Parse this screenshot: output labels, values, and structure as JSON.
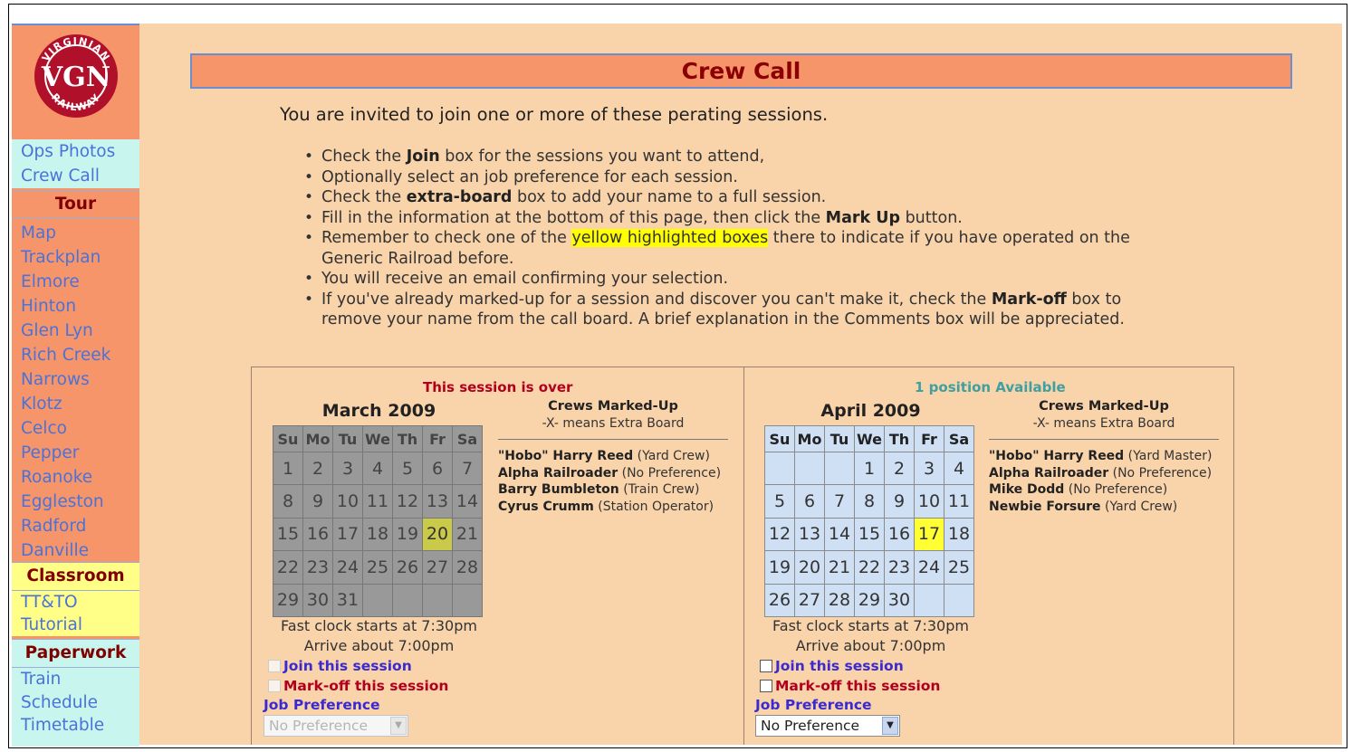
{
  "sidebar": {
    "logo_text": "VIRGINIAN VGN RAILWAY",
    "top_links": [
      "Ops Photos",
      "Crew Call"
    ],
    "tour_heading": "Tour",
    "tour_links": [
      "Map",
      "Trackplan",
      "Elmore",
      "Hinton",
      "Glen Lyn",
      "Rich Creek",
      "Narrows",
      "Klotz",
      "Celco",
      "Pepper",
      "Roanoke",
      "Eggleston",
      "Radford",
      "Danville"
    ],
    "classroom_heading": "Classroom",
    "classroom_links": [
      "TT&TO",
      "Tutorial"
    ],
    "paperwork_heading": "Paperwork",
    "paperwork_links": [
      "Train",
      "Schedule",
      "Timetable"
    ]
  },
  "page": {
    "title": "Crew Call",
    "intro": "You are invited to join one or more of these perating sessions."
  },
  "instructions": {
    "b1_pre": "Check the ",
    "b1_bold": "Join",
    "b1_post": " box for the sessions you want to attend,",
    "b2": "Optionally select an job preference for each session.",
    "b3_pre": "Check the ",
    "b3_bold": "extra-board",
    "b3_post": " box to add your name to a full session.",
    "b4_pre": "Fill in the information at the bottom of this page, then click the ",
    "b4_bold": "Mark Up",
    "b4_post": " button.",
    "b5_pre": "Remember to check one of the ",
    "b5_hl": "yellow highlighted boxes",
    "b5_post": " there to indicate if you have operated on the Generic Railroad before.",
    "b6": "You will receive an email confirming your selection.",
    "b7_pre": "If you've already marked-up for a session and discover you can't make it, check the ",
    "b7_bold": "Mark-off",
    "b7_post": " box to remove your name from the call board. A brief explanation in the Comments box will be appreciated."
  },
  "weekdays": [
    "Su",
    "Mo",
    "Tu",
    "We",
    "Th",
    "Fr",
    "Sa"
  ],
  "sessions": [
    {
      "status": "This session is over",
      "month": "March 2009",
      "weeks": [
        [
          "1",
          "2",
          "3",
          "4",
          "5",
          "6",
          "7"
        ],
        [
          "8",
          "9",
          "10",
          "11",
          "12",
          "13",
          "14"
        ],
        [
          "15",
          "16",
          "17",
          "18",
          "19",
          "20",
          "21"
        ],
        [
          "22",
          "23",
          "24",
          "25",
          "26",
          "27",
          "28"
        ],
        [
          "29",
          "30",
          "31",
          "",
          "",
          "",
          ""
        ]
      ],
      "selected_day": "20",
      "crews_title": "Crews Marked-Up",
      "crews_sub": "-X- means Extra Board",
      "crew": [
        {
          "name": "\"Hobo\" Harry Reed",
          "role": " (Yard Crew)"
        },
        {
          "name": "Alpha Railroader",
          "role": " (No Preference)"
        },
        {
          "name": "Barry Bumbleton",
          "role": " (Train Crew)"
        },
        {
          "name": "Cyrus Crumm",
          "role": " (Station Operator)"
        }
      ],
      "fast_clock": "Fast clock starts at 7:30pm",
      "arrive": "Arrive about 7:00pm",
      "join_label": "Join this session",
      "markoff_label": "Mark-off this session",
      "job_pref_label": "Job Preference",
      "job_pref_value": "No Preference"
    },
    {
      "status": "1 position Available",
      "month": "April 2009",
      "weeks": [
        [
          "",
          "",
          "",
          "1",
          "2",
          "3",
          "4"
        ],
        [
          "5",
          "6",
          "7",
          "8",
          "9",
          "10",
          "11"
        ],
        [
          "12",
          "13",
          "14",
          "15",
          "16",
          "17",
          "18"
        ],
        [
          "19",
          "20",
          "21",
          "22",
          "23",
          "24",
          "25"
        ],
        [
          "26",
          "27",
          "28",
          "29",
          "30",
          "",
          ""
        ]
      ],
      "selected_day": "17",
      "crews_title": "Crews Marked-Up",
      "crews_sub": "-X- means Extra Board",
      "crew": [
        {
          "name": "\"Hobo\" Harry Reed",
          "role": " (Yard Master)"
        },
        {
          "name": "Alpha Railroader",
          "role": " (No Preference)"
        },
        {
          "name": "Mike Dodd",
          "role": " (No Preference)"
        },
        {
          "name": "Newbie Forsure",
          "role": " (Yard Crew)"
        }
      ],
      "fast_clock": "Fast clock starts at 7:30pm",
      "arrive": "Arrive about 7:00pm",
      "join_label": "Join this session",
      "markoff_label": "Mark-off this session",
      "job_pref_label": "Job Preference",
      "job_pref_value": "No Preference"
    }
  ]
}
